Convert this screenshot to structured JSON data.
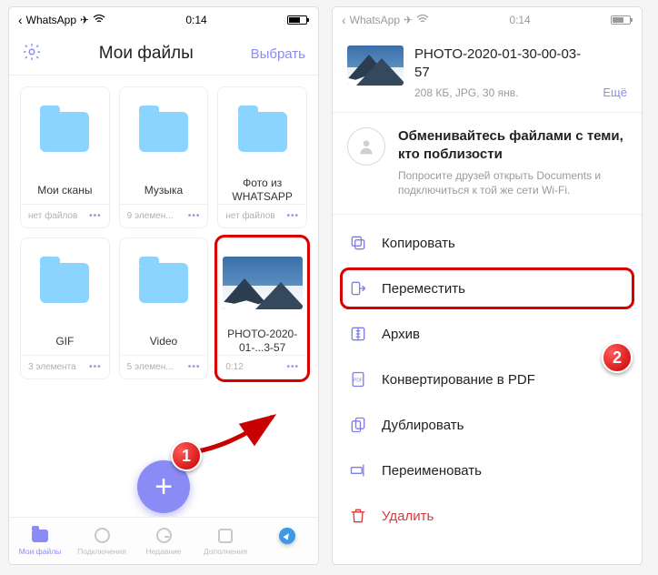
{
  "status": {
    "app": "WhatsApp",
    "time": "0:14"
  },
  "left": {
    "title": "Мои файлы",
    "select": "Выбрать",
    "folders": [
      {
        "name": "Мои сканы",
        "sub": "нет файлов"
      },
      {
        "name": "Музыка",
        "sub": "9 элемен..."
      },
      {
        "name": "Фото из WHATSAPP",
        "sub": "нет файлов"
      },
      {
        "name": "GIF",
        "sub": "3 элемента"
      },
      {
        "name": "Video",
        "sub": "5 элемен..."
      }
    ],
    "photo": {
      "name": "PHOTO-2020-01-...3-57",
      "sub": "0:12"
    },
    "tabs": {
      "files": "Мои файлы",
      "conn": "Подключения",
      "recent": "Недавние",
      "addons": "Дополнения"
    }
  },
  "right": {
    "file": {
      "name": "PHOTO-2020-01-30-00-03-57",
      "meta": "208 КБ, JPG, 30 янв.",
      "more": "Ещё"
    },
    "share": {
      "title": "Обменивайтесь файлами с теми, кто поблизости",
      "desc": "Попросите друзей открыть Documents и подключиться к той же сети Wi-Fi."
    },
    "actions": {
      "copy": "Копировать",
      "move": "Переместить",
      "archive": "Архив",
      "pdf": "Конвертирование в PDF",
      "duplicate": "Дублировать",
      "rename": "Переименовать",
      "delete": "Удалить"
    }
  },
  "badges": {
    "one": "1",
    "two": "2"
  }
}
